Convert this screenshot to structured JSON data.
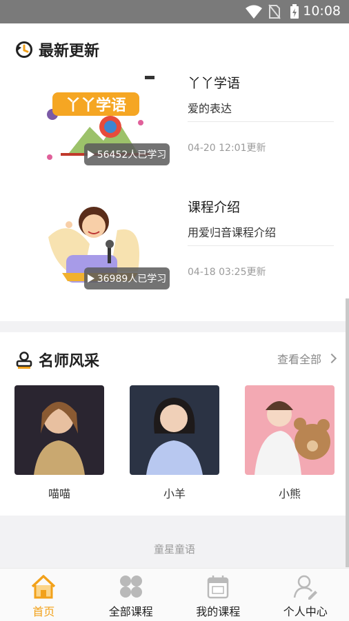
{
  "status_bar": {
    "time": "10:08"
  },
  "latest": {
    "title": "最新更新",
    "courses": [
      {
        "title": "丫丫学语",
        "subtitle": "爱的表达",
        "time": "04-20 12:01更新",
        "learners": "56452人已学习",
        "thumb_text": "丫丫学语"
      },
      {
        "title": "课程介绍",
        "subtitle": "用爱归音课程介绍",
        "time": "04-18 03:25更新",
        "learners": "36989人已学习"
      }
    ]
  },
  "teachers": {
    "title": "名师风采",
    "see_all": "查看全部",
    "items": [
      {
        "name": "喵喵",
        "bg": "#2a2530"
      },
      {
        "name": "小羊",
        "bg": "#2b3344"
      },
      {
        "name": "小熊",
        "bg": "#f3a9b3"
      }
    ]
  },
  "footer": {
    "text": "童星童语"
  },
  "tabs": [
    {
      "label": "首页",
      "active": true
    },
    {
      "label": "全部课程"
    },
    {
      "label": "我的课程"
    },
    {
      "label": "个人中心"
    }
  ],
  "colors": {
    "accent": "#f2a11a"
  }
}
